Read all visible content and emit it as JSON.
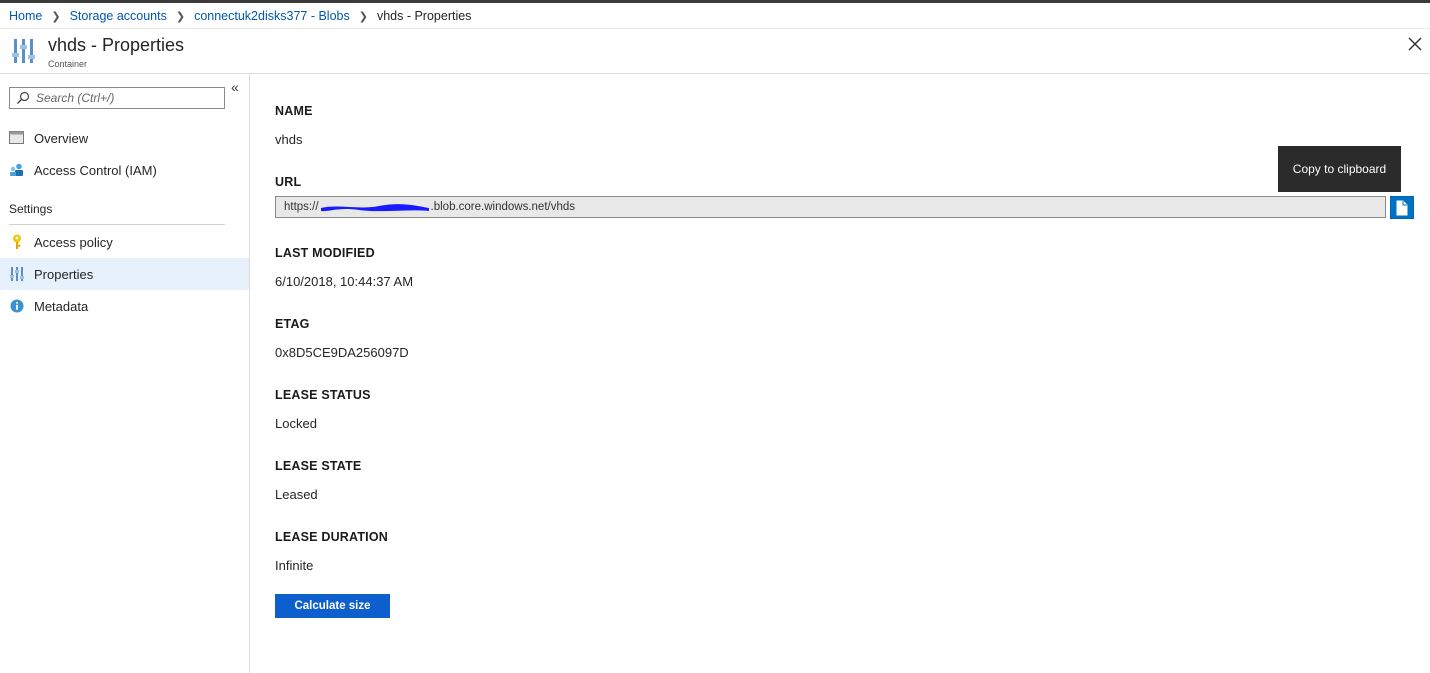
{
  "breadcrumb": {
    "items": [
      {
        "label": "Home"
      },
      {
        "label": "Storage accounts"
      },
      {
        "label": "connectuk2disks377 - Blobs"
      }
    ],
    "current": "vhds - Properties"
  },
  "header": {
    "title": "vhds - Properties",
    "subtitle": "Container",
    "icon": "properties-sliders-icon"
  },
  "sidebar": {
    "search_placeholder": "Search (Ctrl+/)",
    "items": [
      {
        "label": "Overview",
        "icon": "overview-icon"
      },
      {
        "label": "Access Control (IAM)",
        "icon": "iam-people-icon"
      }
    ],
    "section_title": "Settings",
    "settings_items": [
      {
        "label": "Access policy",
        "icon": "key-icon"
      },
      {
        "label": "Properties",
        "icon": "properties-sliders-icon",
        "selected": true
      },
      {
        "label": "Metadata",
        "icon": "info-icon"
      }
    ]
  },
  "properties": {
    "name_label": "NAME",
    "name_value": "vhds",
    "url_label": "URL",
    "url_prefix": "https://",
    "url_suffix": ".blob.core.windows.net/vhds",
    "last_modified_label": "LAST MODIFIED",
    "last_modified_value": "6/10/2018, 10:44:37 AM",
    "etag_label": "ETAG",
    "etag_value": "0x8D5CE9DA256097D",
    "lease_status_label": "LEASE STATUS",
    "lease_status_value": "Locked",
    "lease_state_label": "LEASE STATE",
    "lease_state_value": "Leased",
    "lease_duration_label": "LEASE DURATION",
    "lease_duration_value": "Infinite"
  },
  "tooltip": {
    "text": "Copy to clipboard"
  },
  "actions": {
    "calculate_size_label": "Calculate size"
  },
  "colors": {
    "link": "#0058ad",
    "selected_bg": "#e6f1fb",
    "primary_button": "#0d5fce",
    "redaction": "#1a1aff"
  }
}
